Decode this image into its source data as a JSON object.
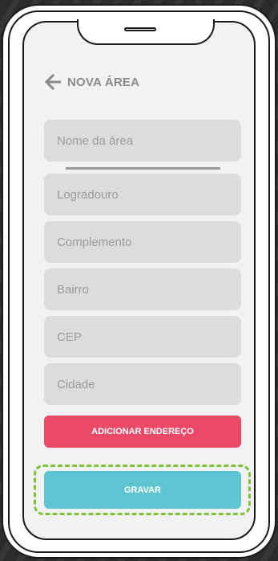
{
  "header": {
    "back_icon": "arrow-left-icon",
    "title": "NOVA ÁREA"
  },
  "form": {
    "fields": [
      {
        "placeholder": "Nome da área",
        "value": ""
      },
      {
        "placeholder": "Logradouro",
        "value": ""
      },
      {
        "placeholder": "Complemento",
        "value": ""
      },
      {
        "placeholder": "Bairro",
        "value": ""
      },
      {
        "placeholder": "CEP",
        "value": ""
      },
      {
        "placeholder": "Cidade",
        "value": ""
      }
    ],
    "add_address_label": "ADICIONAR ENDEREÇO",
    "save_label": "GRAVAR"
  },
  "colors": {
    "background": "#f2f2f2",
    "field": "#dcdcdc",
    "accent_pink": "#ea4a68",
    "accent_teal": "#5ec5d0",
    "highlight_green": "#7ec23b",
    "title_gray": "#8a8a8a"
  }
}
